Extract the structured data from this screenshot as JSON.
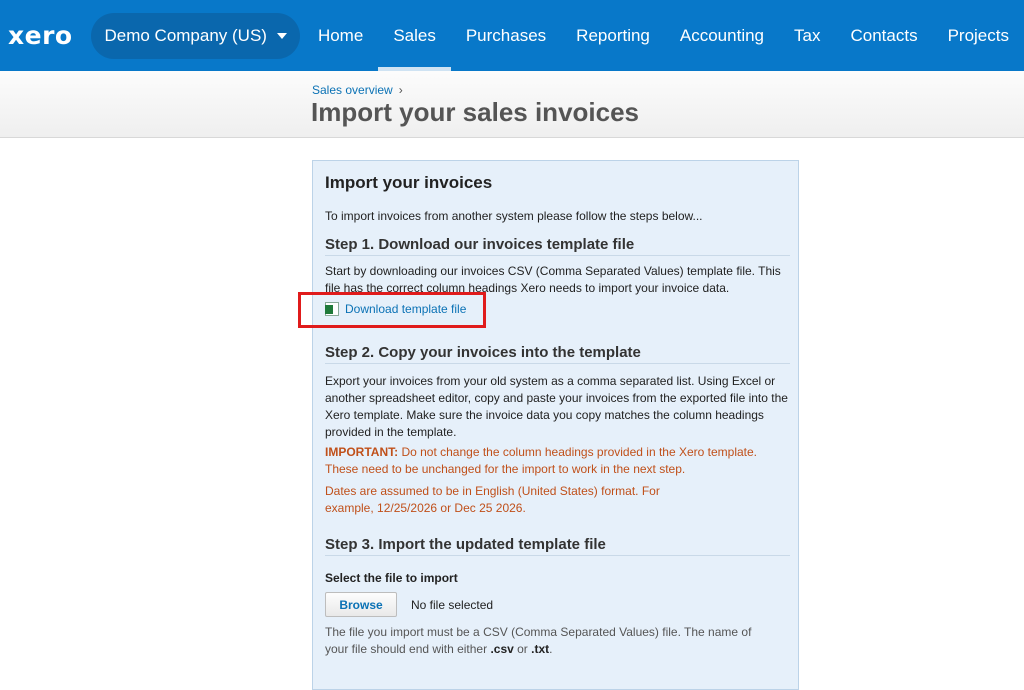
{
  "nav": {
    "logo": "xero",
    "org": "Demo Company (US)",
    "items": [
      {
        "label": "Home"
      },
      {
        "label": "Sales"
      },
      {
        "label": "Purchases"
      },
      {
        "label": "Reporting"
      },
      {
        "label": "Accounting"
      },
      {
        "label": "Tax"
      },
      {
        "label": "Contacts"
      },
      {
        "label": "Projects"
      }
    ],
    "active": "Sales"
  },
  "header": {
    "breadcrumb": "Sales overview",
    "breadcrumb_sep": "›",
    "title": "Import your sales invoices"
  },
  "panel": {
    "title": "Import your invoices",
    "intro": "To import invoices from another system please follow the steps below...",
    "step1": {
      "heading": "Step 1. Download our invoices template file",
      "text": "Start by downloading our invoices CSV (Comma Separated Values) template file. This file has the correct column headings Xero needs to import your invoice data.",
      "link": "Download template file"
    },
    "step2": {
      "heading": "Step 2. Copy your invoices into the template",
      "text": "Export your invoices from your old system as a comma separated list. Using Excel or another spreadsheet editor, copy and paste your invoices from the exported file into the Xero template. Make sure the invoice data you copy matches the column headings provided in the template.",
      "important_label": "IMPORTANT:",
      "important_text": " Do not change the column headings provided in the Xero template. These need to be unchanged for the import to work in the next step.",
      "dates_text": "Dates are assumed to be in English (United States) format. For example, 12/25/2026 or Dec 25 2026."
    },
    "step3": {
      "heading": "Step 3. Import the updated template file",
      "select_label": "Select the file to import",
      "browse": "Browse",
      "no_file": "No file selected",
      "note_pre": "The file you import must be a CSV (Comma Separated Values) file. The name of your file should end with either ",
      "ext_csv": ".csv",
      "note_mid": " or ",
      "ext_txt": ".txt",
      "note_end": "."
    }
  },
  "colors": {
    "nav_bg": "#0878c9",
    "link": "#0b72b5",
    "warning": "#c0501a",
    "highlight": "#e01b1b",
    "panel_bg": "#e6f0fa"
  }
}
